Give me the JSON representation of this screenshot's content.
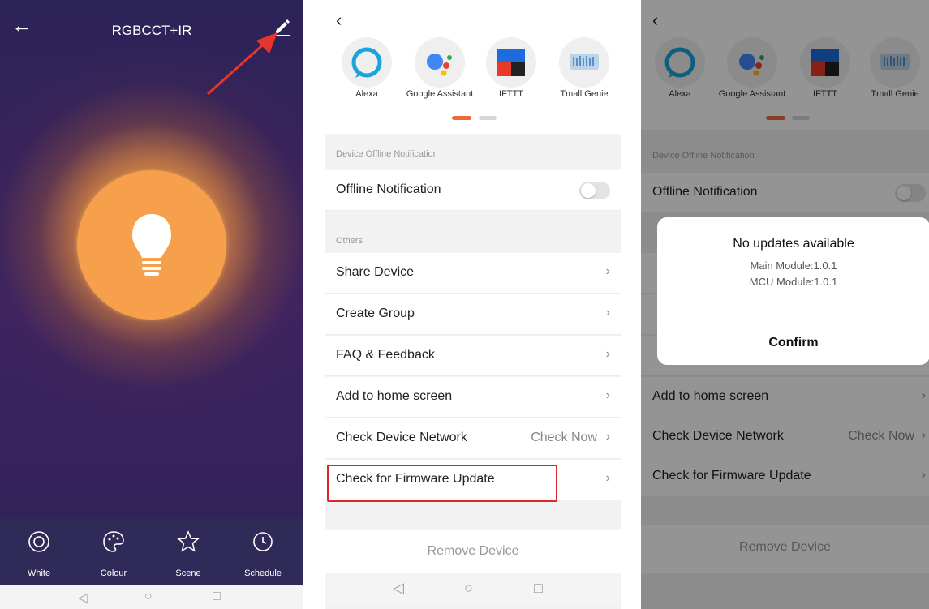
{
  "panel1": {
    "title": "RGBCCT+IR",
    "back_icon": "arrow-left-icon",
    "edit_icon": "pencil-icon",
    "bottom_tabs": [
      {
        "label": "White",
        "icon": "target-circle-icon"
      },
      {
        "label": "Colour",
        "icon": "palette-icon"
      },
      {
        "label": "Scene",
        "icon": "star-icon"
      },
      {
        "label": "Schedule",
        "icon": "clock-icon"
      }
    ],
    "colors": {
      "accent": "#f6a04c",
      "background": "#2e1f58",
      "arrow": "#e8352b"
    }
  },
  "panel2": {
    "services": [
      {
        "name": "Alexa",
        "icon": "alexa-icon"
      },
      {
        "name": "Google Assistant",
        "icon": "google-assistant-icon"
      },
      {
        "name": "IFTTT",
        "icon": "ifttt-icon"
      },
      {
        "name": "Tmall Genie",
        "icon": "tmall-genie-icon"
      }
    ],
    "section_offline": "Device Offline Notification",
    "offline_label": "Offline Notification",
    "section_others": "Others",
    "rows": [
      "Share Device",
      "Create Group",
      "FAQ & Feedback",
      "Add to home screen",
      "Check Device Network",
      "Check for Firmware Update"
    ],
    "check_now": "Check Now",
    "remove": "Remove Device",
    "highlight_color": "#e0262a"
  },
  "panel3": {
    "services": [
      {
        "name": "Alexa"
      },
      {
        "name": "Google Assistant"
      },
      {
        "name": "IFTTT"
      },
      {
        "name": "Tmall Genie"
      }
    ],
    "section_offline": "Device Offline Notification",
    "offline_label": "Offline Notification",
    "rows": [
      "Add to home screen",
      "Check Device Network",
      "Check for Firmware Update"
    ],
    "check_now": "Check Now",
    "remove": "Remove Device",
    "dialog": {
      "title": "No updates available",
      "line1": "Main Module:1.0.1",
      "line2": "MCU Module:1.0.1",
      "confirm": "Confirm"
    }
  }
}
